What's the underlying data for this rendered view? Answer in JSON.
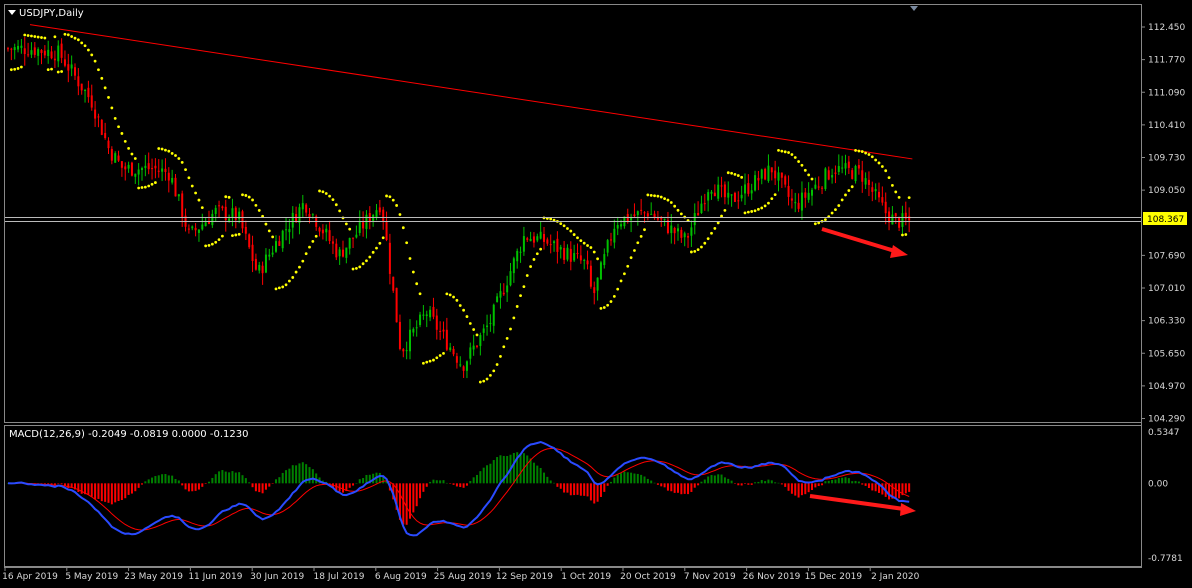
{
  "window": {
    "symbol_timeframe": "USDJPY,Daily",
    "macd_label": "MACD(12,26,9) -0.2049 -0.0819 0.0000 -0.1230"
  },
  "colors": {
    "background": "#000000",
    "bull_candle": "#00c000",
    "bear_candle": "#ff0000",
    "psar": "#ffff00",
    "trendline": "#ff0000",
    "macd_main": "#2a4bff",
    "macd_signal": "#ff0000",
    "hist_pos": "#008000",
    "hist_neg": "#ff0000",
    "price_tag_bg": "#ffff00",
    "arrow": "#ff0000"
  },
  "chart_data": [
    {
      "type": "candlestick",
      "symbol": "USDJPY",
      "timeframe": "Daily",
      "y_ticks": [
        "112.450",
        "111.770",
        "111.090",
        "110.410",
        "109.730",
        "109.050",
        "108.367",
        "107.690",
        "107.010",
        "106.330",
        "105.650",
        "104.970",
        "104.290"
      ],
      "ylim": [
        104.29,
        112.45
      ],
      "current_price": "108.367",
      "x_labels": [
        "16 Apr 2019",
        "5 May 2019",
        "23 May 2019",
        "11 Jun 2019",
        "30 Jun 2019",
        "18 Jul 2019",
        "6 Aug 2019",
        "25 Aug 2019",
        "12 Sep 2019",
        "1 Oct 2019",
        "20 Oct 2019",
        "7 Nov 2019",
        "26 Nov 2019",
        "15 Dec 2019",
        "2 Jan 2020"
      ],
      "close_path": [
        {
          "date": "16 Apr 2019",
          "close": 112.0
        },
        {
          "date": "25 Apr 2019",
          "close": 111.9
        },
        {
          "date": "28 Apr 2019",
          "close": 111.6
        },
        {
          "date": "5 May 2019",
          "close": 110.9
        },
        {
          "date": "10 May 2019",
          "close": 109.9
        },
        {
          "date": "14 May 2019",
          "close": 109.5
        },
        {
          "date": "23 May 2019",
          "close": 109.5
        },
        {
          "date": "28 May 2019",
          "close": 109.4
        },
        {
          "date": "3 Jun 2019",
          "close": 108.1
        },
        {
          "date": "11 Jun 2019",
          "close": 108.6
        },
        {
          "date": "18 Jun 2019",
          "close": 108.5
        },
        {
          "date": "24 Jun 2019",
          "close": 107.3
        },
        {
          "date": "30 Jun 2019",
          "close": 108.0
        },
        {
          "date": "8 Jul 2019",
          "close": 108.8
        },
        {
          "date": "18 Jul 2019",
          "close": 107.7
        },
        {
          "date": "24 Jul 2019",
          "close": 108.2
        },
        {
          "date": "31 Jul 2019",
          "close": 108.8
        },
        {
          "date": "6 Aug 2019",
          "close": 105.7
        },
        {
          "date": "14 Aug 2019",
          "close": 106.5
        },
        {
          "date": "25 Aug 2019",
          "close": 105.4
        },
        {
          "date": "2 Sep 2019",
          "close": 106.3
        },
        {
          "date": "12 Sep 2019",
          "close": 108.1
        },
        {
          "date": "18 Sep 2019",
          "close": 108.0
        },
        {
          "date": "1 Oct 2019",
          "close": 107.5
        },
        {
          "date": "3 Oct 2019",
          "close": 106.8
        },
        {
          "date": "10 Oct 2019",
          "close": 108.4
        },
        {
          "date": "20 Oct 2019",
          "close": 108.6
        },
        {
          "date": "31 Oct 2019",
          "close": 108.0
        },
        {
          "date": "7 Nov 2019",
          "close": 109.2
        },
        {
          "date": "13 Nov 2019",
          "close": 108.8
        },
        {
          "date": "26 Nov 2019",
          "close": 109.5
        },
        {
          "date": "3 Dec 2019",
          "close": 108.7
        },
        {
          "date": "15 Dec 2019",
          "close": 109.5
        },
        {
          "date": "23 Dec 2019",
          "close": 109.4
        },
        {
          "date": "30 Dec 2019",
          "close": 108.6
        },
        {
          "date": "2 Jan 2020",
          "close": 108.4
        }
      ],
      "trendline": {
        "from": {
          "date": "16 Apr 2019",
          "price": 112.5
        },
        "to": {
          "date": "7 Jan 2020",
          "price": 109.7
        }
      },
      "annotations": [
        "red arrow pointing down to recent low (Dec 2019 - Jan 2020)"
      ]
    },
    {
      "type": "macd",
      "title": "MACD(12,26,9) -0.2049 -0.0819 0.0000 -0.1230",
      "y_ticks": [
        "0.5347",
        "0.00",
        "-0.7781"
      ],
      "ylim": [
        -0.7781,
        0.5347
      ],
      "annotations": [
        "red arrow pointing down-right on MACD lows (late Dec 2019 - Jan 2020)"
      ]
    }
  ]
}
